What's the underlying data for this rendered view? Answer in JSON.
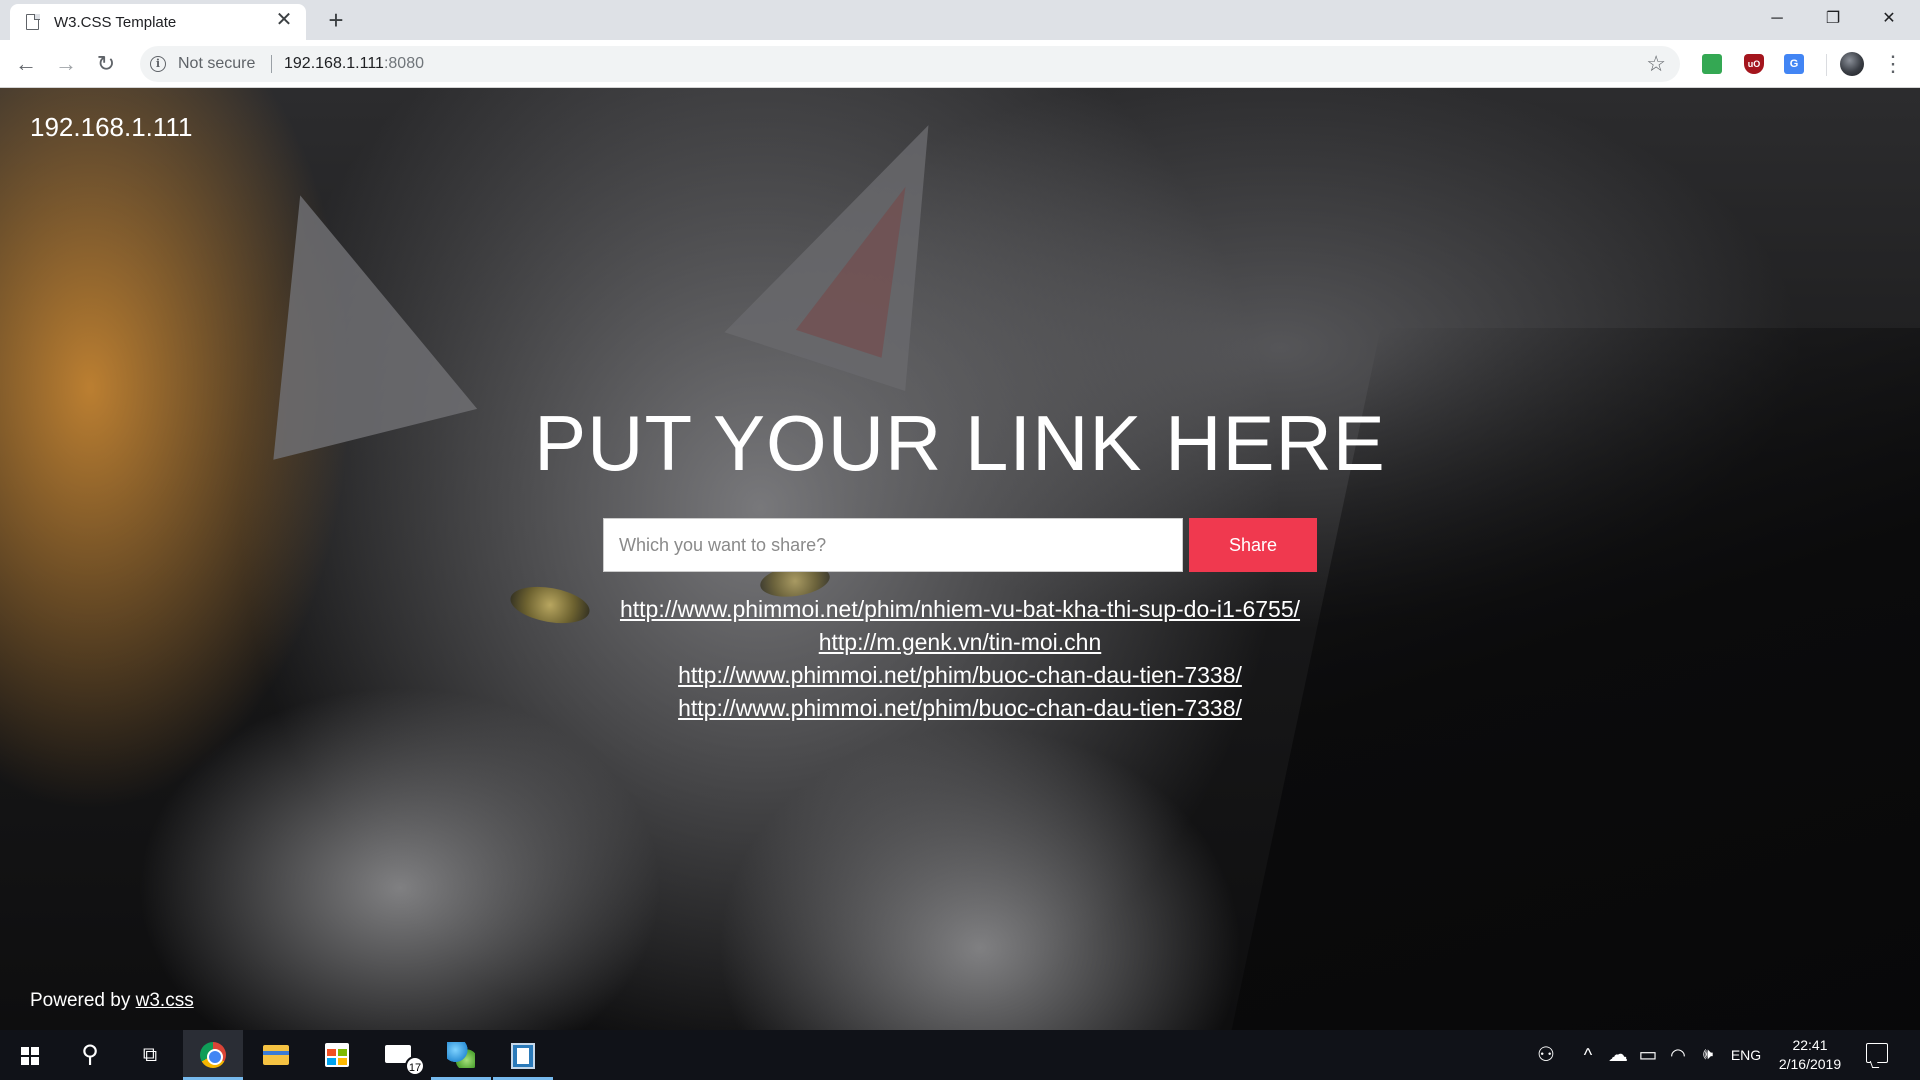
{
  "browser": {
    "tab_title": "W3.CSS Template",
    "tab_close": "✕",
    "new_tab": "+",
    "window_controls": {
      "minimize": "─",
      "maximize": "❐",
      "close": "✕"
    },
    "nav": {
      "back": "←",
      "forward": "→",
      "reload": "↻"
    },
    "omnibox": {
      "security_text": "Not secure",
      "url_host": "192.168.1.111",
      "url_port": ":8080"
    },
    "star": "☆",
    "extensions": [
      {
        "name": "green-extension-icon",
        "color": "#34a853",
        "glyph": ""
      },
      {
        "name": "ublock-extension-icon",
        "color": "#a4151d",
        "glyph": "uO"
      },
      {
        "name": "translate-extension-icon",
        "color": "#4285f4",
        "glyph": "G"
      }
    ],
    "menu": "⋮"
  },
  "page": {
    "host_label": "192.168.1.111",
    "hero_title": "PUT YOUR LINK HERE",
    "input_placeholder": "Which you want to share?",
    "share_label": "Share",
    "links": [
      "http://www.phimmoi.net/phim/nhiem-vu-bat-kha-thi-sup-do-i1-6755/",
      "http://m.genk.vn/tin-moi.chn",
      "http://www.phimmoi.net/phim/buoc-chan-dau-tien-7338/",
      "http://www.phimmoi.net/phim/buoc-chan-dau-tien-7338/"
    ],
    "footer_prefix": "Powered by ",
    "footer_link": "w3.css",
    "colors": {
      "share_button": "#f0394f",
      "text": "#ffffff"
    }
  },
  "taskbar": {
    "search_glyph": "⚲",
    "task_view_glyph": "⧉",
    "mail_badge": "17",
    "tray": {
      "people_glyph": "⚇",
      "chevron_glyph": "^",
      "cloud_glyph": "☁",
      "battery_glyph": "▭",
      "wifi_glyph": "◠",
      "volume_glyph": "🕪",
      "language": "ENG",
      "time": "22:41",
      "date": "2/16/2019"
    }
  }
}
